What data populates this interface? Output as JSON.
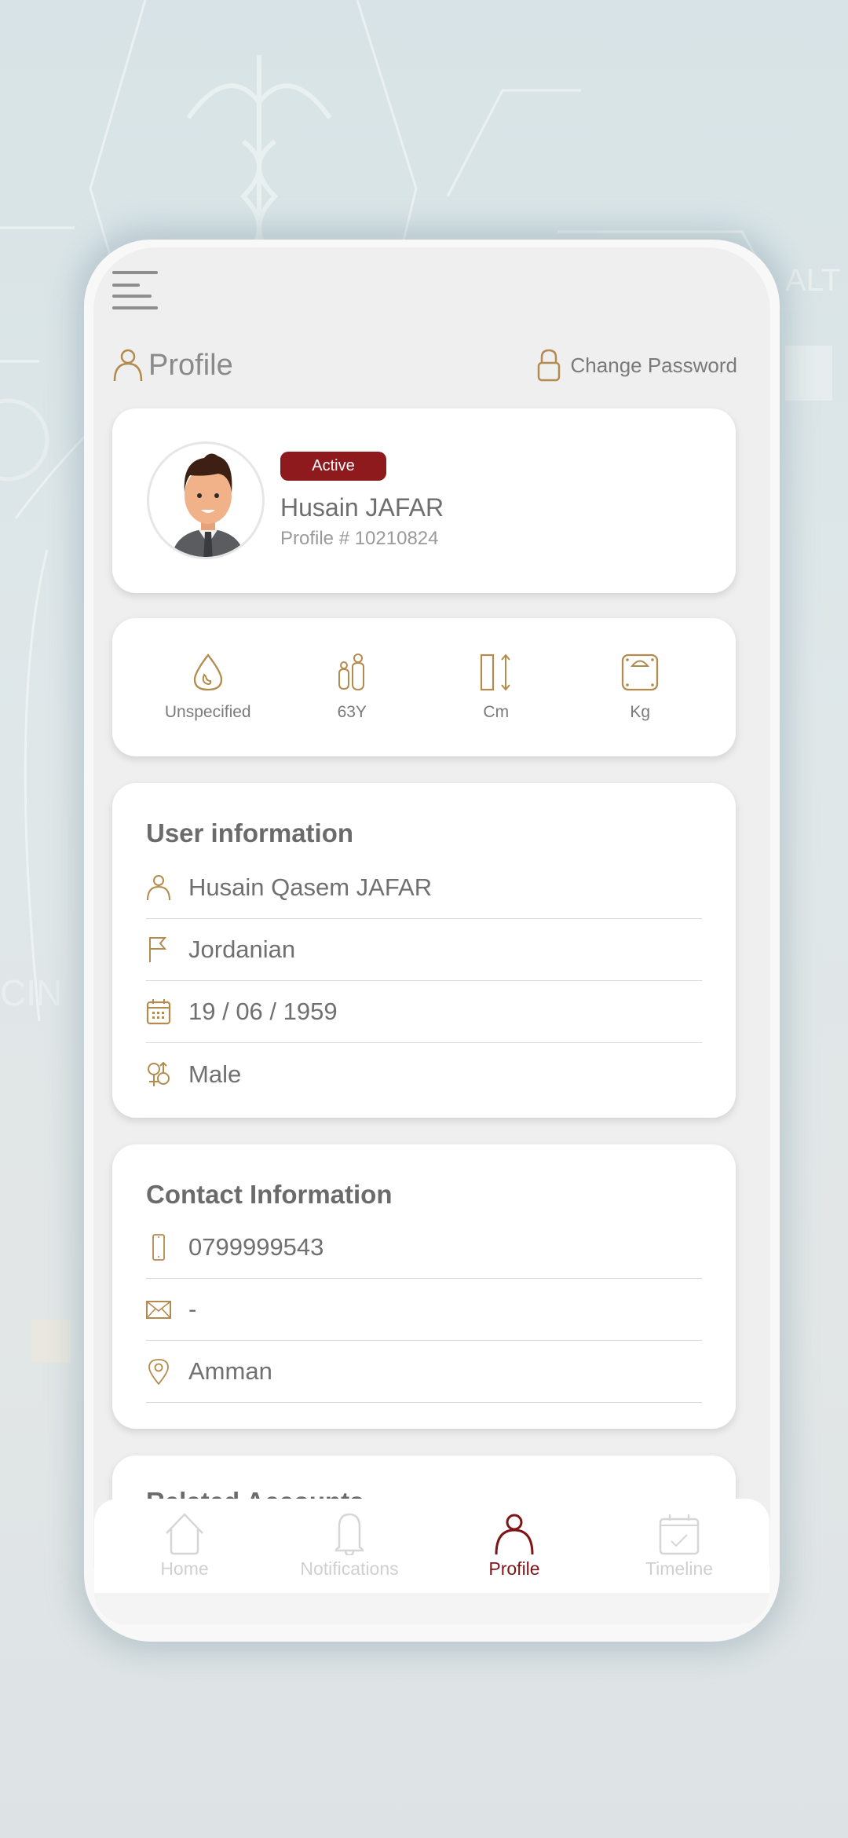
{
  "colors": {
    "accent_gold": "#b38b4d",
    "active_red": "#8f1a1d",
    "nav_active": "#7d1518",
    "nav_inactive": "#d0d0d0",
    "text_gray": "#707070"
  },
  "header": {
    "menu_icon": "hamburger-menu-icon",
    "title": "Profile",
    "title_icon": "user-icon",
    "change_password_label": "Change Password",
    "change_password_icon": "lock-icon"
  },
  "profile_card": {
    "status": "Active",
    "name": "Husain JAFAR",
    "profile_number": "Profile # 10210824",
    "avatar": "male-avatar-illustration"
  },
  "stats": [
    {
      "icon": "blood-drop-icon",
      "label": "Unspecified"
    },
    {
      "icon": "age-people-icon",
      "label": "63Y"
    },
    {
      "icon": "height-icon",
      "label": "Cm"
    },
    {
      "icon": "weight-scale-icon",
      "label": "Kg"
    }
  ],
  "user_information": {
    "title": "User information",
    "rows": [
      {
        "icon": "user-icon",
        "value": "Husain Qasem JAFAR"
      },
      {
        "icon": "flag-icon",
        "value": "Jordanian"
      },
      {
        "icon": "calendar-icon",
        "value": "19 / 06 / 1959"
      },
      {
        "icon": "gender-icon",
        "value": "Male"
      }
    ]
  },
  "contact_information": {
    "title": "Contact Information",
    "rows": [
      {
        "icon": "phone-icon",
        "value": "0799999543"
      },
      {
        "icon": "mail-icon",
        "value": "-"
      },
      {
        "icon": "location-pin-icon",
        "value": "Amman"
      }
    ]
  },
  "related_accounts": {
    "title": "Related Accounts"
  },
  "bottom_nav": [
    {
      "icon": "home-icon",
      "label": "Home",
      "active": false
    },
    {
      "icon": "bell-icon",
      "label": "Notifications",
      "active": false
    },
    {
      "icon": "user-icon",
      "label": "Profile",
      "active": true
    },
    {
      "icon": "calendar-check-icon",
      "label": "Timeline",
      "active": false
    }
  ]
}
